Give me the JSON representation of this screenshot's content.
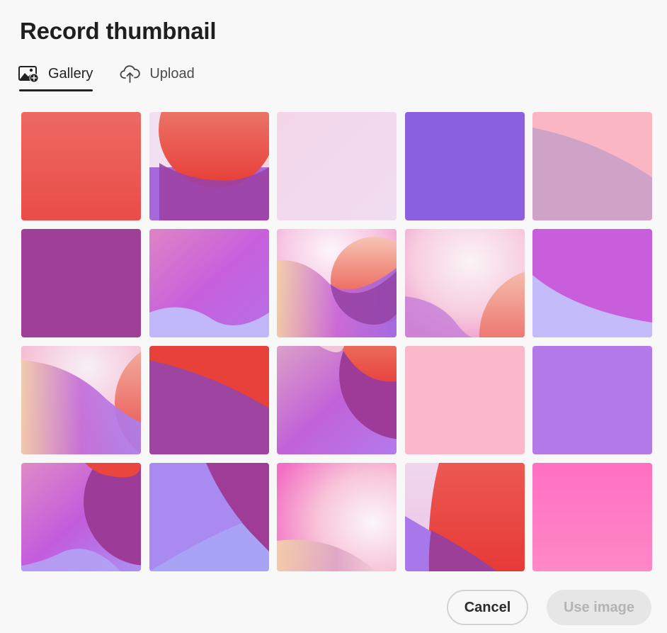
{
  "dialog": {
    "title": "Record thumbnail"
  },
  "tabs": [
    {
      "label": "Gallery",
      "icon": "image-add-icon",
      "selected": true
    },
    {
      "label": "Upload",
      "icon": "cloud-upload-icon",
      "selected": false
    }
  ],
  "gallery": {
    "rows": 4,
    "columns": 5,
    "tile_count": 20,
    "colors": {
      "red": "#ec5149",
      "pink": "#fbb8c8",
      "lavender": "#f0dced",
      "violet": "#8860e0",
      "plum": "#9e3f98",
      "orchid": "#c85fdc",
      "periwinkle": "#c3bbfa",
      "hot_pink": "#ff74c4"
    }
  },
  "footer": {
    "cancel_label": "Cancel",
    "use_image_label": "Use image",
    "use_image_enabled": false
  }
}
